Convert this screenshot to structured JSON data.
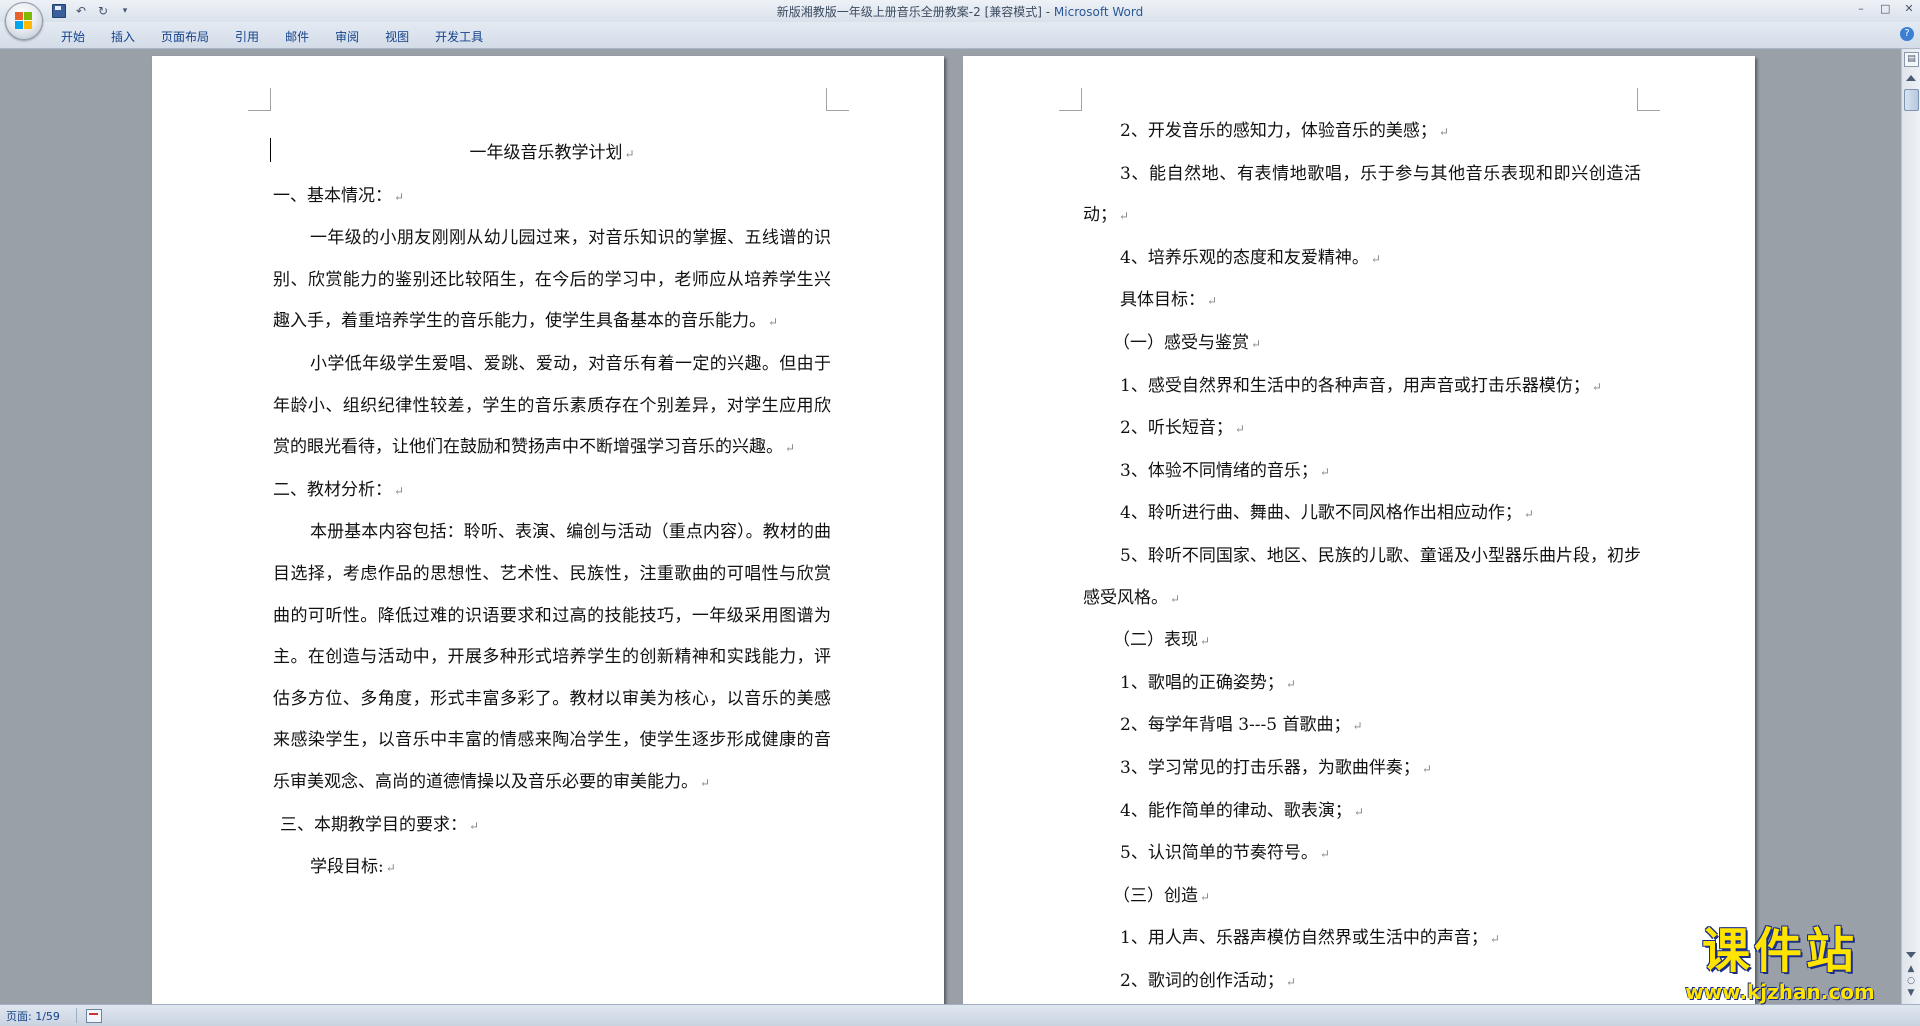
{
  "window": {
    "title": "新版湘教版一年级上册音乐全册教案-2 [兼容模式]",
    "app_name": "Microsoft Word",
    "title_separator": " - "
  },
  "ribbon": {
    "tabs": [
      "开始",
      "插入",
      "页面布局",
      "引用",
      "邮件",
      "审阅",
      "视图",
      "开发工具"
    ]
  },
  "document": {
    "left_page": [
      {
        "text": "一年级音乐教学计划",
        "style": "center"
      },
      {
        "text": "一、基本情况：",
        "style": ""
      },
      {
        "text": "一年级的小朋友刚刚从幼儿园过来，对音乐知识的掌握、五线谱的识别、欣赏能力的鉴别还比较陌生，在今后的学习中，老师应从培养学生兴趣入手，着重培养学生的音乐能力，使学生具备基本的音乐能力。",
        "style": "ind"
      },
      {
        "text": "小学低年级学生爱唱、爱跳、爱动，对音乐有着一定的兴趣。但由于年龄小、组织纪律性较差，学生的音乐素质存在个别差异，对学生应用欣赏的眼光看待，让他们在鼓励和赞扬声中不断增强学习音乐的兴趣。",
        "style": "ind"
      },
      {
        "text": "二、教材分析：",
        "style": ""
      },
      {
        "text": "本册基本内容包括：聆听、表演、编创与活动（重点内容）。教材的曲目选择，考虑作品的思想性、艺术性、民族性，注重歌曲的可唱性与欣赏曲的可听性。降低过难的识语要求和过高的技能技巧，一年级采用图谱为主。在创造与活动中，开展多种形式培养学生的创新精神和实践能力，评估多方位、多角度，形式丰富多彩了。教材以审美为核心，以音乐的美感来感染学生，以音乐中丰富的情感来陶冶学生，使学生逐步形成健康的音乐审美观念、高尚的道德情操以及音乐必要的审美能力。",
        "style": "ind"
      },
      {
        "text": "三、本期教学目的要求：",
        "style": "hang1"
      },
      {
        "text": "学段目标:",
        "style": "ind"
      }
    ],
    "right_page": [
      {
        "text": "2、开发音乐的感知力，体验音乐的美感；",
        "style": "ind"
      },
      {
        "text": "3、能自然地、有表情地歌唱，乐于参与其他音乐表现和即兴创造活动；",
        "style": "ind"
      },
      {
        "text": "4、培养乐观的态度和友爱精神。",
        "style": "ind"
      },
      {
        "text": "具体目标：",
        "style": "ind"
      },
      {
        "text": "（一）感受与鉴赏",
        "style": "paren"
      },
      {
        "text": "1、感受自然界和生活中的各种声音，用声音或打击乐器模仿；",
        "style": "ind"
      },
      {
        "text": "2、听长短音；",
        "style": "ind"
      },
      {
        "text": "3、体验不同情绪的音乐；",
        "style": "ind"
      },
      {
        "text": "4、聆听进行曲、舞曲、儿歌不同风格作出相应动作；",
        "style": "ind"
      },
      {
        "text": "5、聆听不同国家、地区、民族的儿歌、童谣及小型器乐曲片段，初步感受风格。",
        "style": "ind"
      },
      {
        "text": "（二）表现",
        "style": "paren"
      },
      {
        "text": "1、歌唱的正确姿势；",
        "style": "ind"
      },
      {
        "text": "2、每学年背唱 3---5 首歌曲；",
        "style": "ind"
      },
      {
        "text": "3、学习常见的打击乐器，为歌曲伴奏；",
        "style": "ind"
      },
      {
        "text": "4、能作简单的律动、歌表演；",
        "style": "ind"
      },
      {
        "text": "5、认识简单的节奏符号。",
        "style": "ind"
      },
      {
        "text": "（三）创造",
        "style": "paren"
      },
      {
        "text": "1、用人声、乐器声模仿自然界或生活中的声音；",
        "style": "ind"
      },
      {
        "text": "2、歌词的创作活动；",
        "style": "ind"
      }
    ],
    "paragraph_mark": "↵"
  },
  "statusbar": {
    "page_info": "页面: 1/59"
  },
  "watermark": {
    "title": "课件站",
    "url": "www.kjzhan.com"
  },
  "colors": {
    "workspace": "#9aa0a8",
    "ribbon_text": "#15428b",
    "watermark_fill": "#ffe400",
    "watermark_outline": "#1b2d8a"
  }
}
